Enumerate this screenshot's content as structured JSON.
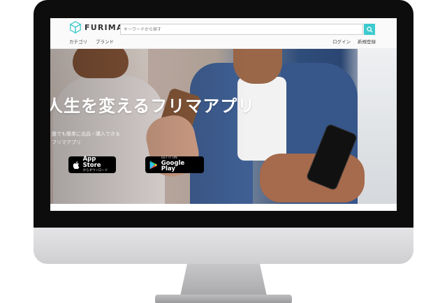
{
  "site": {
    "logo_text": "FURIMA"
  },
  "search": {
    "placeholder": "キーワードから探す"
  },
  "nav": {
    "category": "カテゴリ",
    "brand": "ブランド",
    "login": "ログイン",
    "signup": "新規登録"
  },
  "hero": {
    "title": "人生を変えるフリマアプリ",
    "subtitle_line1": "誰でも簡単に出品・購入できる",
    "subtitle_line2": "フリマアプリ"
  },
  "app_store": {
    "line1": "App Store",
    "line2": "からダウンロード"
  },
  "google_play": {
    "line1": "GET IT ON",
    "line2": "Google Play"
  },
  "colors": {
    "accent": "#3ccace",
    "bezel": "#0d0d0d"
  }
}
